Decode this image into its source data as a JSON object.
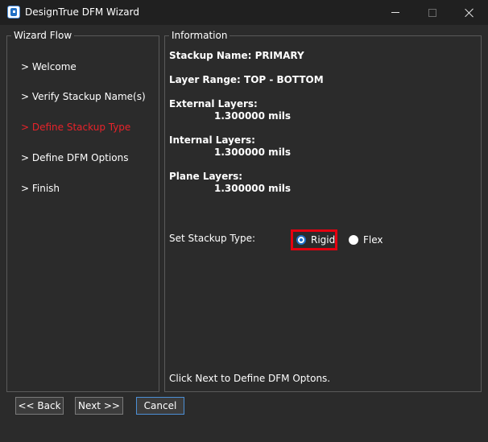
{
  "window": {
    "title": "DesignTrue DFM Wizard"
  },
  "flow": {
    "legend": "Wizard Flow",
    "items": [
      {
        "label": "> Welcome",
        "active": false
      },
      {
        "label": "> Verify Stackup Name(s)",
        "active": false
      },
      {
        "label": "> Define Stackup Type",
        "active": true
      },
      {
        "label": "> Define DFM Options",
        "active": false
      },
      {
        "label": "> Finish",
        "active": false
      }
    ]
  },
  "info": {
    "legend": "Information",
    "stackup_name": "Stackup Name: PRIMARY",
    "layer_range": "Layer Range: TOP - BOTTOM",
    "external_label": "External Layers:",
    "external_value": "1.300000 mils",
    "internal_label": "Internal Layers:",
    "internal_value": "1.300000 mils",
    "plane_label": "Plane Layers:",
    "plane_value": "1.300000 mils",
    "stackup_type_label": "Set Stackup Type:",
    "rigid_label": "Rigid",
    "flex_label": "Flex",
    "selected_type": "Rigid",
    "hint": "Click Next to Define DFM Optons."
  },
  "buttons": {
    "back": "<< Back",
    "next": "Next >>",
    "cancel": "Cancel"
  },
  "colors": {
    "active_step": "#e8232a",
    "highlight_frame": "#e5000f",
    "radio_accent": "#1f6fc5"
  }
}
